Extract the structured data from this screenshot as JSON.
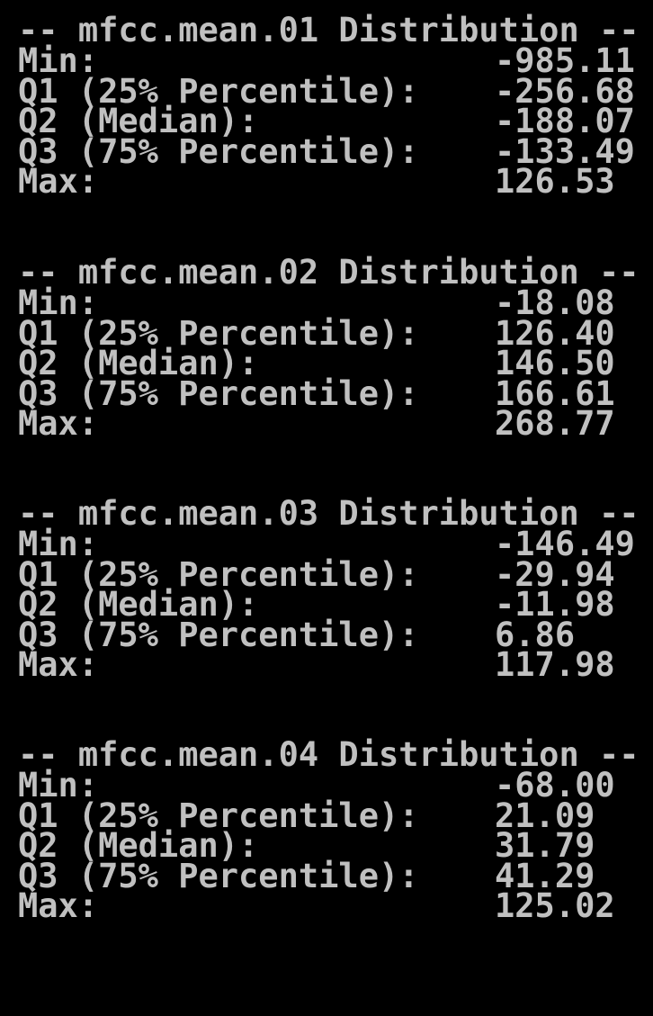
{
  "colors": {
    "background": "#000000",
    "text": "#c0c0c0"
  },
  "blocks": [
    {
      "heading": "-- mfcc.mean.01 Distribution --",
      "rows": [
        {
          "label": "Min:",
          "value": "-985.11"
        },
        {
          "label": "Q1 (25% Percentile):",
          "value": "-256.68"
        },
        {
          "label": "Q2 (Median):",
          "value": "-188.07"
        },
        {
          "label": "Q3 (75% Percentile):",
          "value": "-133.49"
        },
        {
          "label": "Max:",
          "value": "126.53"
        }
      ]
    },
    {
      "heading": "-- mfcc.mean.02 Distribution --",
      "rows": [
        {
          "label": "Min:",
          "value": "-18.08"
        },
        {
          "label": "Q1 (25% Percentile):",
          "value": "126.40"
        },
        {
          "label": "Q2 (Median):",
          "value": "146.50"
        },
        {
          "label": "Q3 (75% Percentile):",
          "value": "166.61"
        },
        {
          "label": "Max:",
          "value": "268.77"
        }
      ]
    },
    {
      "heading": "-- mfcc.mean.03 Distribution --",
      "rows": [
        {
          "label": "Min:",
          "value": "-146.49"
        },
        {
          "label": "Q1 (25% Percentile):",
          "value": "-29.94"
        },
        {
          "label": "Q2 (Median):",
          "value": "-11.98"
        },
        {
          "label": "Q3 (75% Percentile):",
          "value": "6.86"
        },
        {
          "label": "Max:",
          "value": "117.98"
        }
      ]
    },
    {
      "heading": "-- mfcc.mean.04 Distribution --",
      "rows": [
        {
          "label": "Min:",
          "value": "-68.00"
        },
        {
          "label": "Q1 (25% Percentile):",
          "value": "21.09"
        },
        {
          "label": "Q2 (Median):",
          "value": "31.79"
        },
        {
          "label": "Q3 (75% Percentile):",
          "value": "41.29"
        },
        {
          "label": "Max:",
          "value": "125.02"
        }
      ]
    }
  ]
}
